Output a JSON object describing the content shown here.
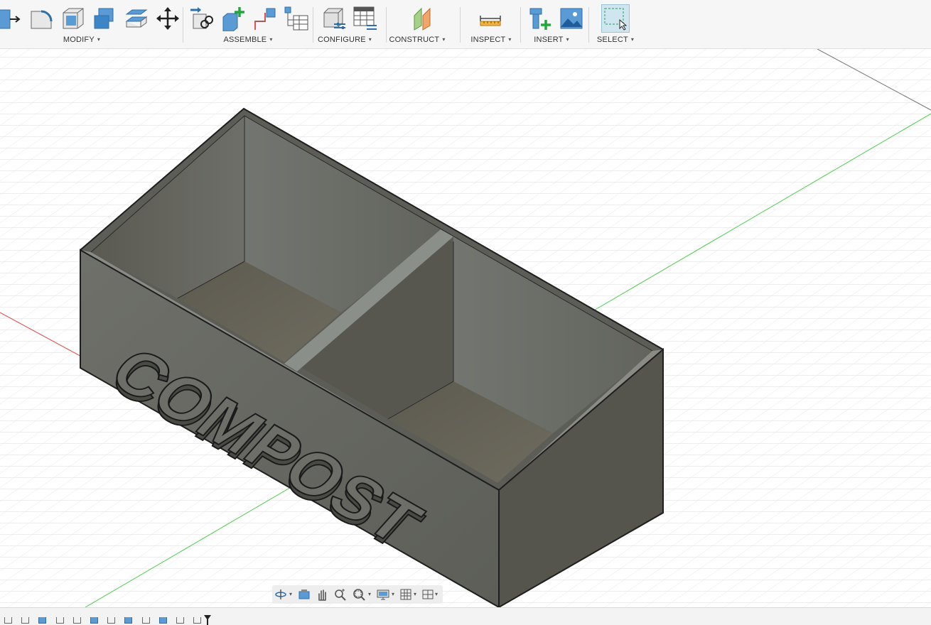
{
  "toolbar": {
    "groups": [
      {
        "label": "MODIFY",
        "icons": [
          "press-pull-icon",
          "fillet-icon",
          "shell-icon",
          "combine-icon",
          "offset-face-icon",
          "move-icon"
        ]
      },
      {
        "label": "ASSEMBLE",
        "icons": [
          "joint-icon",
          "new-component-icon",
          "as-built-joint-icon",
          "bill-of-materials-icon"
        ]
      },
      {
        "label": "CONFIGURE",
        "icons": [
          "configure-model-icon",
          "configuration-table-icon"
        ]
      },
      {
        "label": "CONSTRUCT",
        "icons": [
          "offset-plane-icon"
        ]
      },
      {
        "label": "INSPECT",
        "icons": [
          "measure-icon"
        ]
      },
      {
        "label": "INSERT",
        "icons": [
          "insert-mcmaster-icon",
          "insert-canvas-icon"
        ]
      },
      {
        "label": "SELECT",
        "icons": [
          "window-select-icon"
        ]
      }
    ],
    "caret": "▾"
  },
  "viewport": {
    "model_text": "COMPOST",
    "colors": {
      "body": "#6e6f69",
      "inner": "#5f5f58",
      "floor": "#6b6a5f",
      "divider": "#8a8e88",
      "x_axis": "#e05252",
      "y_axis": "#4ecb4e",
      "grid": "#d6d6d6"
    }
  },
  "navbar": {
    "buttons": [
      "orbit-icon",
      "look-at-icon",
      "pan-icon",
      "zoom-icon",
      "fit-icon",
      "display-settings-icon",
      "grid-settings-icon",
      "viewports-icon"
    ]
  },
  "timeline": {
    "step_count": 12
  }
}
